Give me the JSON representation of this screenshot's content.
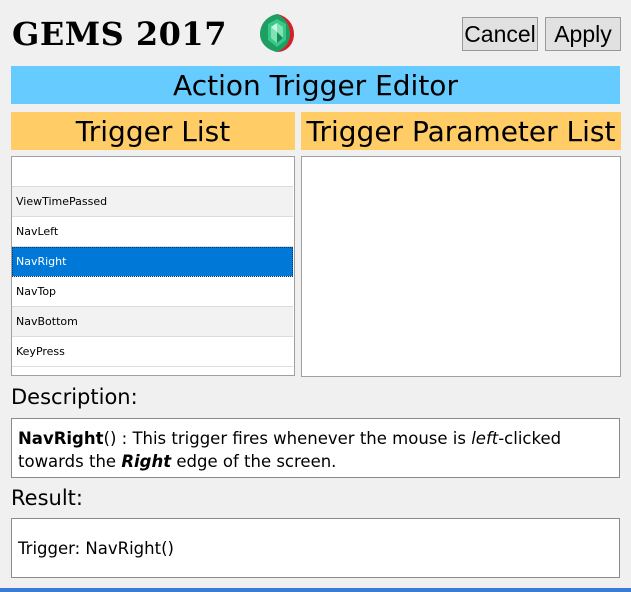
{
  "header": {
    "app_title": "GEMS 2017",
    "logo_icon": "green-gem-icon",
    "cancel_label": "Cancel",
    "apply_label": "Apply"
  },
  "editor_title": "Action Trigger Editor",
  "trigger_list": {
    "heading": "Trigger List",
    "items": [
      "",
      "ViewTimePassed",
      "NavLeft",
      "NavRight",
      "NavTop",
      "NavBottom",
      "KeyPress"
    ],
    "selected": "NavRight"
  },
  "param_list": {
    "heading": "Trigger Parameter List"
  },
  "description": {
    "label": "Description:",
    "name": "NavRight",
    "text_1": "() : This trigger fires whenever the mouse is ",
    "emph_1": "left",
    "text_2": "-clicked towards the ",
    "emph_2": "Right",
    "text_3": " edge of the screen."
  },
  "result": {
    "label": "Result:",
    "value": "Trigger: NavRight()"
  },
  "colors": {
    "banner": "#66ccff",
    "section_head": "#ffcc66",
    "selection": "#0078d7",
    "gem_green": "#22b573",
    "gem_red": "#d4202a"
  }
}
